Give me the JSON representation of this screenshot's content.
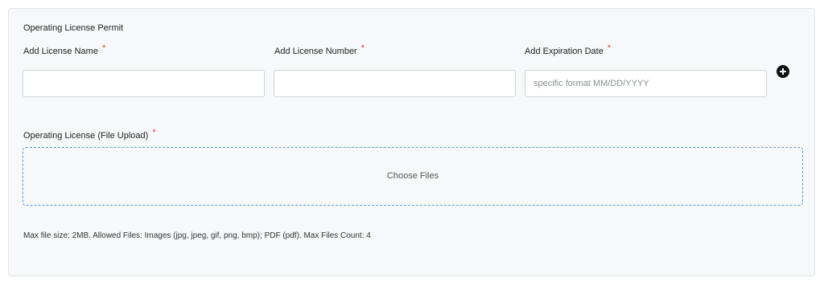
{
  "form": {
    "section_title": "Operating License Permit",
    "required_marker": "*",
    "fields": [
      {
        "label": "Add License Name",
        "value": "",
        "placeholder": ""
      },
      {
        "label": "Add License Number",
        "value": "",
        "placeholder": ""
      },
      {
        "label": "Add Expiration Date",
        "value": "",
        "placeholder": "specific format MM/DD/YYYY"
      }
    ],
    "add_icon": "plus-circle-icon",
    "upload": {
      "label": "Operating License (File Upload)",
      "button_text": "Choose Files",
      "help_text": "Max file size: 2MB. Allowed Files: Images (jpg, jpeg, gif, png, bmp); PDF (pdf). Max Files Count: 4"
    }
  },
  "colors": {
    "panel_background": "#f7f8f9",
    "required": "#e53935",
    "dropzone_border": "#5b9bd5",
    "input_border": "#cfd4da"
  }
}
